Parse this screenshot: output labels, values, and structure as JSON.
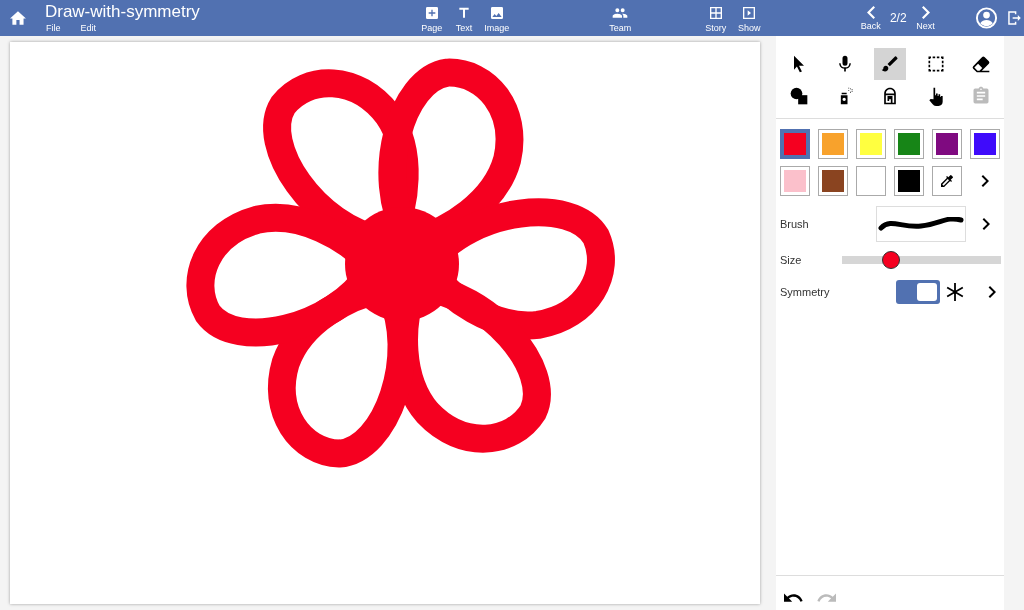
{
  "header": {
    "title": "Draw-with-symmetry",
    "menus": [
      "File",
      "Edit"
    ],
    "buttons": [
      {
        "kind": "page",
        "label": "Page"
      },
      {
        "kind": "text",
        "label": "Text"
      },
      {
        "kind": "image",
        "label": "Image"
      },
      {
        "kind": "team",
        "label": "Team"
      },
      {
        "kind": "story",
        "label": "Story"
      },
      {
        "kind": "show",
        "label": "Show"
      }
    ],
    "nav": {
      "back": "Back",
      "page": "2/2",
      "next": "Next"
    }
  },
  "tools": [
    {
      "kind": "pointer",
      "selected": false,
      "disabled": false
    },
    {
      "kind": "mic",
      "selected": false,
      "disabled": false
    },
    {
      "kind": "brush",
      "selected": true,
      "disabled": false
    },
    {
      "kind": "marquee",
      "selected": false,
      "disabled": false
    },
    {
      "kind": "eraser",
      "selected": false,
      "disabled": false
    },
    {
      "kind": "shapes",
      "selected": false,
      "disabled": false
    },
    {
      "kind": "spray",
      "selected": false,
      "disabled": false
    },
    {
      "kind": "bucket",
      "selected": false,
      "disabled": false
    },
    {
      "kind": "hand",
      "selected": false,
      "disabled": false
    },
    {
      "kind": "paste",
      "selected": false,
      "disabled": true
    }
  ],
  "colors": [
    {
      "color": "#f50020",
      "selected": true
    },
    {
      "color": "#f8a22c",
      "selected": false
    },
    {
      "color": "#ffff40",
      "selected": false
    },
    {
      "color": "#178517",
      "selected": false
    },
    {
      "color": "#7f0a80",
      "selected": false
    },
    {
      "color": "#3f0bfb",
      "selected": false
    },
    {
      "color": "#fbc0cb",
      "selected": false
    },
    {
      "color": "#8a4420",
      "selected": false
    },
    {
      "color": "#ffffff",
      "selected": false
    },
    {
      "color": "#000000",
      "selected": false
    }
  ],
  "brush": {
    "label": "Brush"
  },
  "size": {
    "label": "Size",
    "level": 0.31
  },
  "symmetry": {
    "label": "Symmetry",
    "on": true
  },
  "history": {
    "undo_disabled": false,
    "redo_disabled": true
  }
}
